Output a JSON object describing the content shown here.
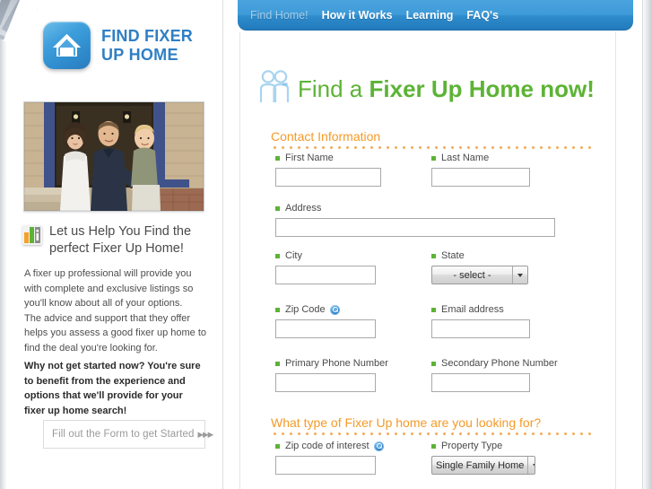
{
  "brand": {
    "logo_icon": "house-icon",
    "name_line1": "FIND FIXER",
    "name_line2": "UP HOME"
  },
  "nav": {
    "items": [
      {
        "label": "Find Home!",
        "active": true
      },
      {
        "label": "How it Works",
        "active": false
      },
      {
        "label": "Learning",
        "active": false
      },
      {
        "label": "FAQ's",
        "active": false
      }
    ]
  },
  "sidebar": {
    "photo_alt": "family-photo",
    "help_icon": "info-bars-icon",
    "help_title": "Let us Help You Find the perfect Fixer Up Home!",
    "body_copy": "A fixer up professional will provide you with complete and exclusive listings so you'll know about all of your options.\nThe advice and support that they offer helps you assess a good fixer up home to find the deal you're looking for.",
    "bold_copy": "Why not get started now? You're sure to benefit from the experience and options that we'll provide for your fixer up home search!",
    "cta_label": "Fill out the Form to get Started",
    "cta_arrows": "▶▶▶"
  },
  "main": {
    "title_icon": "two-people-icon",
    "title_light": "Find a ",
    "title_bold": "Fixer Up Home now!",
    "sections": [
      {
        "heading": "Contact Information"
      },
      {
        "heading": "What type of Fixer Up home are you looking for?"
      }
    ],
    "fields": {
      "first_name": {
        "label": "First Name",
        "value": "",
        "placeholder": ""
      },
      "last_name": {
        "label": "Last Name",
        "value": "",
        "placeholder": ""
      },
      "address": {
        "label": "Address",
        "value": "",
        "placeholder": ""
      },
      "city": {
        "label": "City",
        "value": "",
        "placeholder": ""
      },
      "state": {
        "label": "State",
        "selected": "- select -"
      },
      "zip_code": {
        "label": "Zip Code",
        "value": "",
        "placeholder": "",
        "help_icon": "help-search-icon"
      },
      "email": {
        "label": "Email address",
        "value": "",
        "placeholder": ""
      },
      "primary_phone": {
        "label": "Primary Phone Number",
        "value": "",
        "placeholder": ""
      },
      "secondary_phone": {
        "label": "Secondary Phone Number",
        "value": "",
        "placeholder": ""
      },
      "zip_interest": {
        "label": "Zip code of interest",
        "value": "",
        "placeholder": "",
        "help_icon": "help-search-icon"
      },
      "property_type": {
        "label": "Property Type",
        "selected": "Single Family Home"
      }
    }
  },
  "colors": {
    "nav_blue": "#2f8ccd",
    "brand_blue": "#2f7fc4",
    "green": "#5cb335",
    "orange": "#f59a28",
    "required_green": "#5cb335"
  }
}
